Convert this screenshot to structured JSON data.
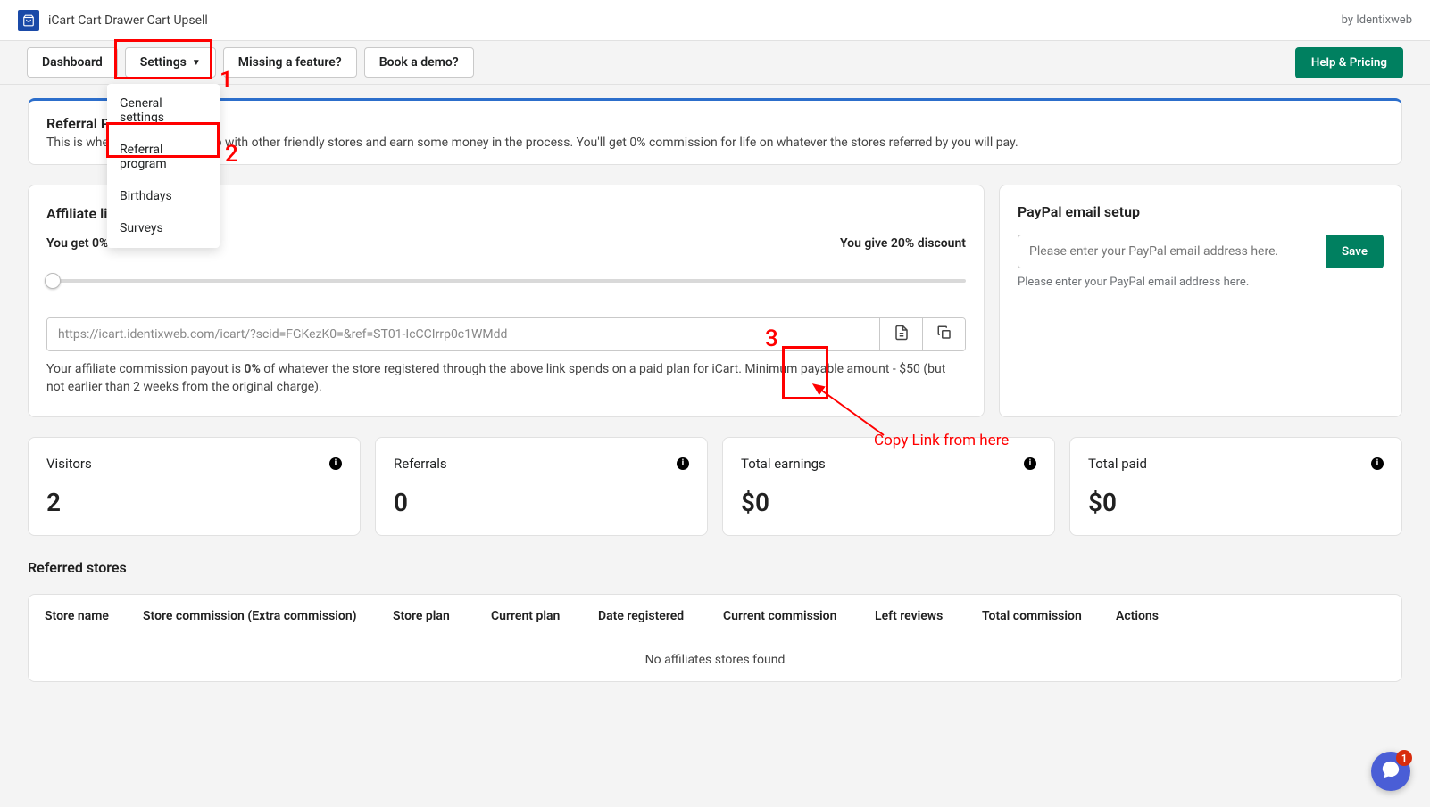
{
  "app": {
    "title": "iCart Cart Drawer Cart Upsell",
    "by": "by Identixweb"
  },
  "nav": {
    "dashboard": "Dashboard",
    "settings": "Settings",
    "missing": "Missing a feature?",
    "demo": "Book a demo?",
    "help": "Help & Pricing"
  },
  "dropdown": {
    "general": "General settings",
    "referral": "Referral program",
    "birthdays": "Birthdays",
    "surveys": "Surveys"
  },
  "banner": {
    "title": "Referral Program",
    "text": "This is where you share our app with other friendly stores and earn some money in the process. You'll get 0% commission for life on whatever the stores referred by you will pay."
  },
  "affiliate": {
    "title": "Affiliate link",
    "left": "You get 0% commission",
    "right": "You give 20% discount",
    "url": "https://icart.identixweb.com/icart/?scid=FGKezK0=&ref=ST01-IcCCIrrp0c1WMdd",
    "desc_pre": "Your affiliate commission payout is ",
    "desc_bold": "0%",
    "desc_post": " of whatever the store registered through the above link spends on a paid plan for iCart. Minimum payable amount - $50 (but not earlier than 2 weeks from the original charge)."
  },
  "paypal": {
    "title": "PayPal email setup",
    "placeholder": "Please enter your PayPal email address here.",
    "save": "Save",
    "help": "Please enter your PayPal email address here."
  },
  "stats": [
    {
      "label": "Visitors",
      "value": "2"
    },
    {
      "label": "Referrals",
      "value": "0"
    },
    {
      "label": "Total earnings",
      "value": "$0"
    },
    {
      "label": "Total paid",
      "value": "$0"
    }
  ],
  "referred": {
    "title": "Referred stores",
    "cols": [
      "Store name",
      "Store commission (Extra commission)",
      "Store plan",
      "Current plan",
      "Date registered",
      "Current commission",
      "Left reviews",
      "Total commission",
      "Actions"
    ],
    "empty": "No affiliates stores found"
  },
  "anno": {
    "one": "1",
    "two": "2",
    "three": "3",
    "copy": "Copy Link from here"
  },
  "chat": {
    "badge": "1"
  }
}
